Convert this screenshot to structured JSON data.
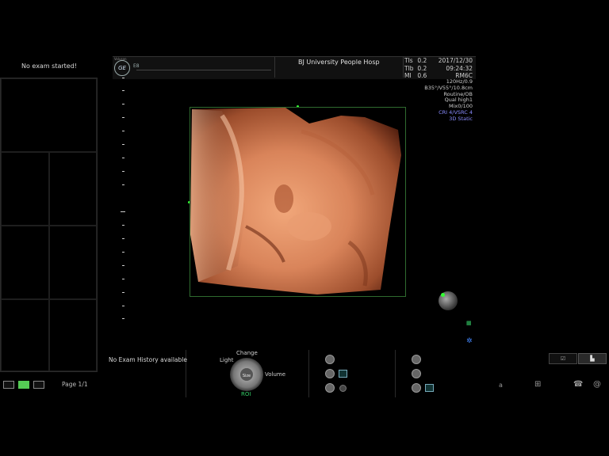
{
  "left_panel": {
    "exam_status": "No exam started!",
    "history": "No Exam History available",
    "page": "Page 1/1"
  },
  "header": {
    "ge_logo": "GE",
    "ge_top": "Voluson",
    "ge_sub": "E8",
    "hospital": "BJ  University  People Hosp",
    "tis_label": "TIs",
    "tis_value": "0.2",
    "tib_label": "TIb",
    "tib_value": "0.2",
    "mi_label": "MI",
    "mi_value": "0.6",
    "date": "2017/12/30",
    "time": "09:24:32",
    "probe": "RM6C"
  },
  "params": {
    "line1": "120Hz/0.9",
    "line2": "B35°/V55°/10.8cm",
    "line3": "Routine/OB",
    "line4": "Qual high1",
    "line5": "Mix0/100",
    "line6": "CRI 4/VSRC 4",
    "line7": "3D Static"
  },
  "controls": {
    "knob_change": "Change",
    "knob_light": "Light",
    "knob_volume": "Volume",
    "knob_roi": "ROI",
    "knob_size": "Size"
  },
  "right_tools": {
    "view1_icon": "☑",
    "view2_icon": "▙",
    "tool_a": "a"
  },
  "colors": {
    "accent_green": "#33cc66",
    "params_blue": "#8a8cff",
    "skin_tone": "#d9845a"
  }
}
